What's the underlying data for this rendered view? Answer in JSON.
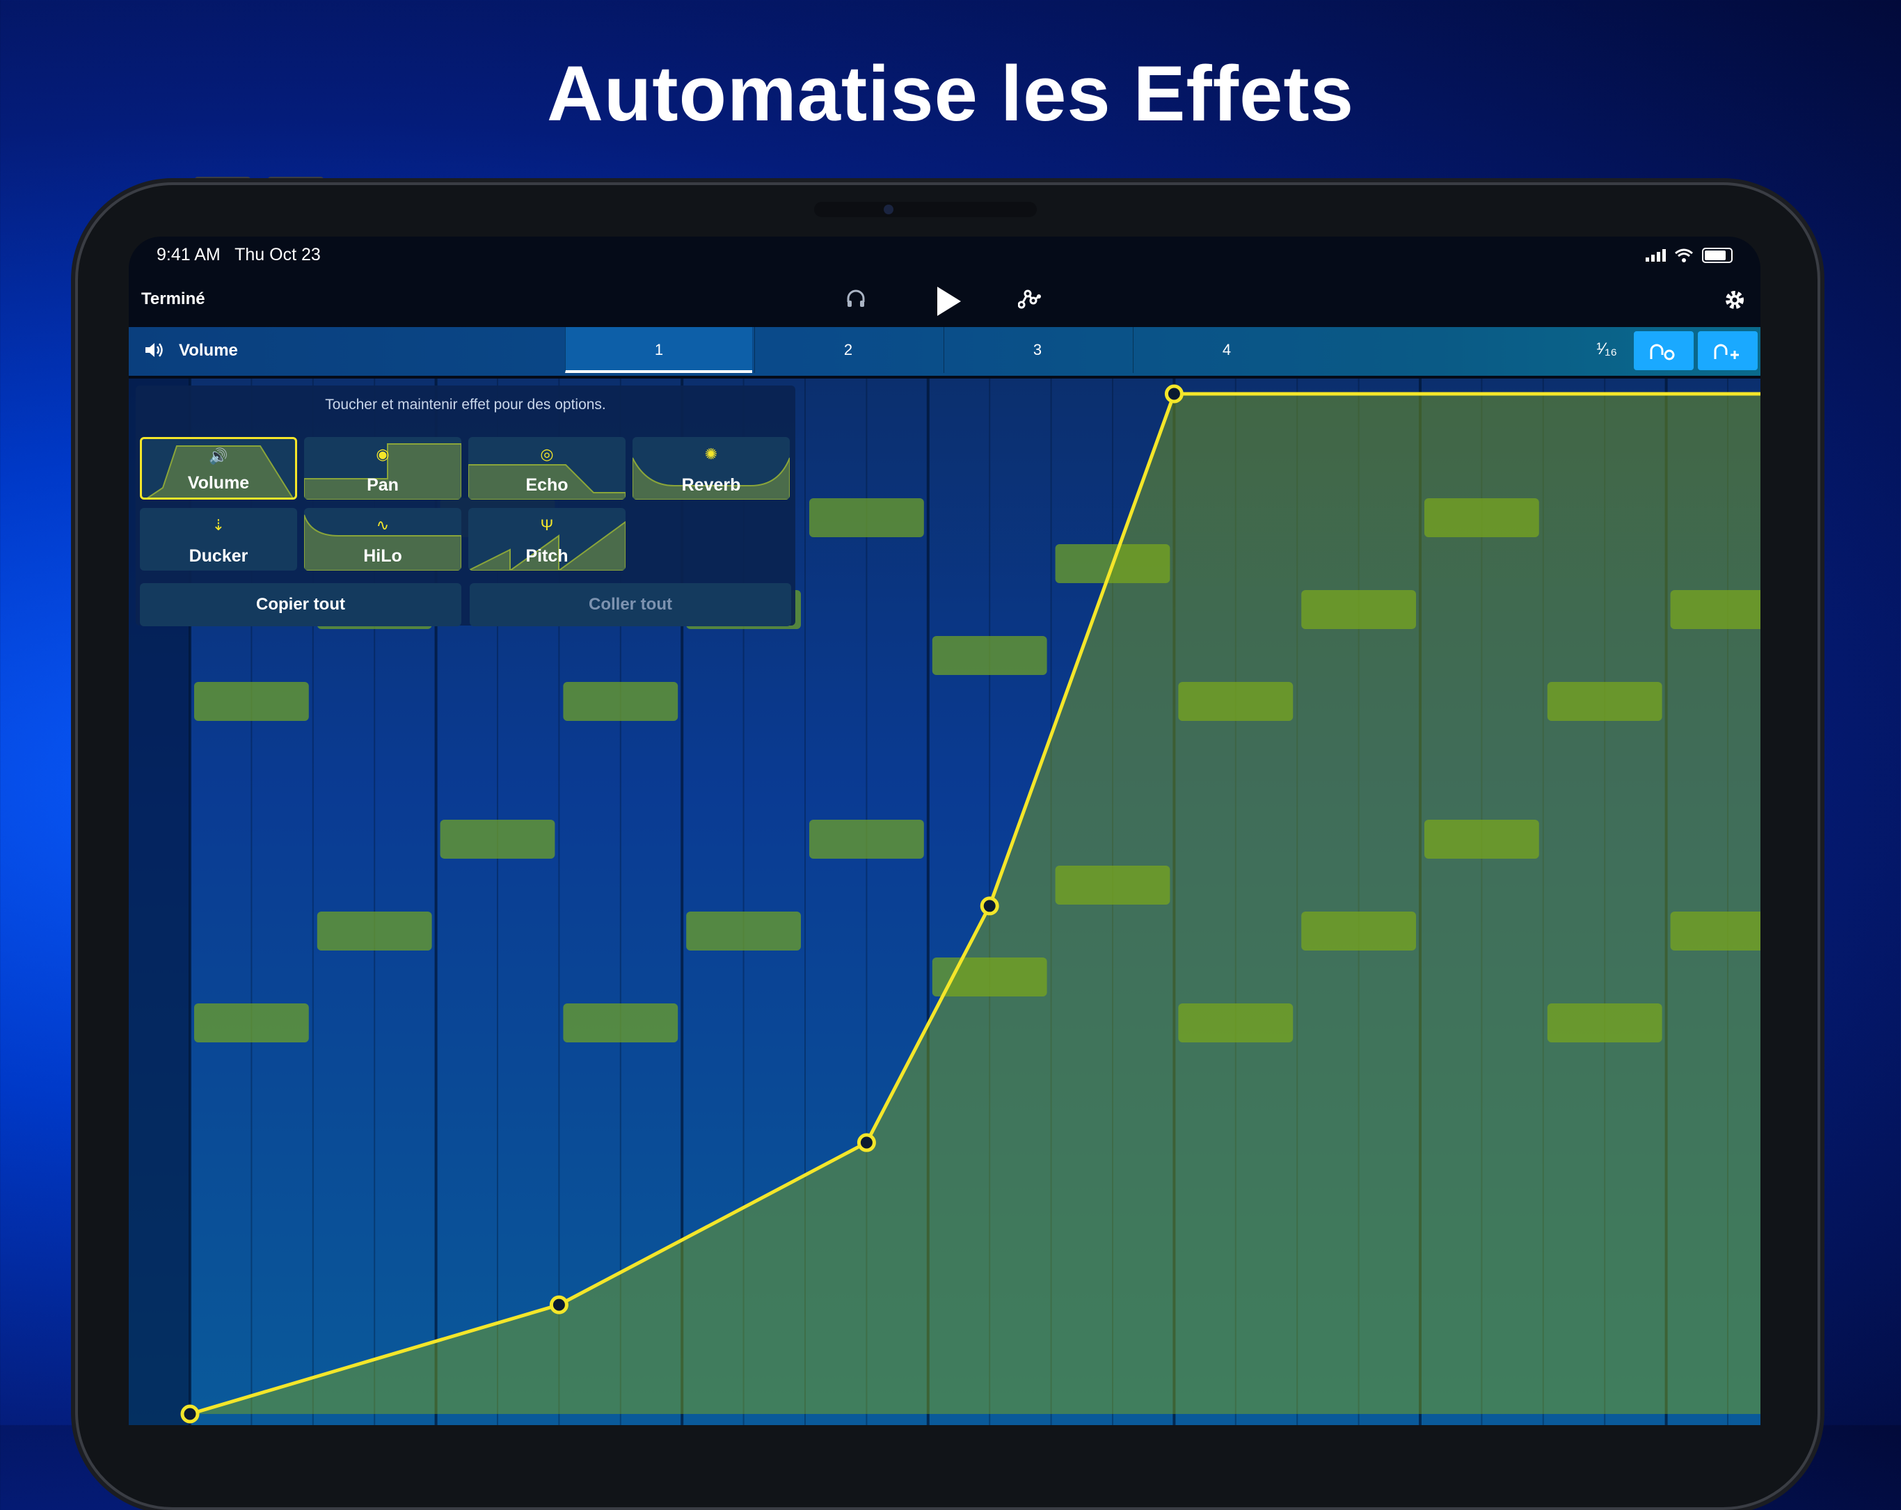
{
  "headline": "Automatise les Effets",
  "status": {
    "time": "9:41 AM",
    "date": "Thu Oct 23"
  },
  "toolbar": {
    "done_label": "Terminé",
    "icons": [
      "headphones-icon",
      "play-icon",
      "automation-nodes-icon",
      "gear-icon"
    ]
  },
  "track": {
    "name": "Volume",
    "bars": [
      "1",
      "2",
      "3",
      "4"
    ],
    "active_bar": "1",
    "grid": "¹⁄₁₆"
  },
  "panel": {
    "hint": "Toucher et maintenir effet pour des options.",
    "effects": [
      {
        "label": "Volume",
        "icon": "speaker-icon",
        "selected": true
      },
      {
        "label": "Pan",
        "icon": "pan-icon",
        "selected": false
      },
      {
        "label": "Echo",
        "icon": "echo-icon",
        "selected": false
      },
      {
        "label": "Reverb",
        "icon": "reverb-icon",
        "selected": false
      },
      {
        "label": "Ducker",
        "icon": "ducker-icon",
        "selected": false
      },
      {
        "label": "HiLo",
        "icon": "hilo-icon",
        "selected": false
      },
      {
        "label": "Pitch",
        "icon": "pitch-icon",
        "selected": false
      }
    ],
    "copy_label": "Copier tout",
    "paste_label": "Coller tout"
  },
  "automation": {
    "points": [
      {
        "step": 0,
        "level": 0.0
      },
      {
        "step": 6,
        "level": 0.107
      },
      {
        "step": 11,
        "level": 0.266
      },
      {
        "step": 13,
        "level": 0.498
      },
      {
        "step": 16,
        "level": 1.0
      },
      {
        "step": 25.6,
        "level": 1.0
      }
    ],
    "colors": {
      "line": "#f4e62a",
      "accent": "#1aa9ff"
    }
  },
  "notes": [
    {
      "step": 0,
      "row": 4
    },
    {
      "step": 0,
      "row": 11
    },
    {
      "step": 2,
      "row": 2
    },
    {
      "step": 2,
      "row": 9
    },
    {
      "step": 4,
      "row": 0
    },
    {
      "step": 4,
      "row": 7
    },
    {
      "step": 6,
      "row": 4
    },
    {
      "step": 6,
      "row": 11
    },
    {
      "step": 8,
      "row": 2
    },
    {
      "step": 8,
      "row": 9
    },
    {
      "step": 10,
      "row": 0
    },
    {
      "step": 10,
      "row": 7
    },
    {
      "step": 12,
      "row": 3
    },
    {
      "step": 12,
      "row": 10
    },
    {
      "step": 14,
      "row": 1
    },
    {
      "step": 14,
      "row": 8
    },
    {
      "step": 16,
      "row": 4
    },
    {
      "step": 16,
      "row": 11
    },
    {
      "step": 18,
      "row": 2
    },
    {
      "step": 18,
      "row": 9
    },
    {
      "step": 20,
      "row": 0
    },
    {
      "step": 20,
      "row": 7
    },
    {
      "step": 22,
      "row": 4
    },
    {
      "step": 22,
      "row": 11
    },
    {
      "step": 24,
      "row": 2
    },
    {
      "step": 24,
      "row": 9
    }
  ]
}
